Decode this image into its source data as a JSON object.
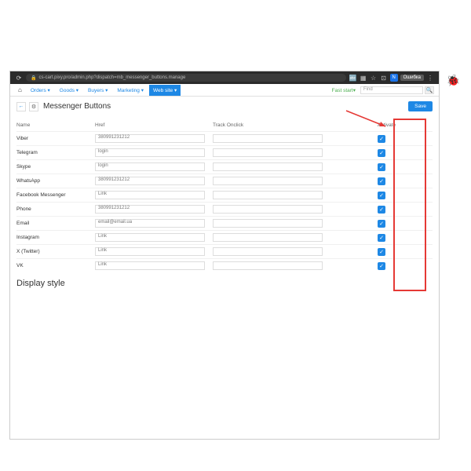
{
  "browser": {
    "url": "cs-cart.pixy.pro/admin.php?dispatch=mb_messenger_buttons.manage",
    "profile_initial": "N",
    "error_label": "Ошибка"
  },
  "nav": {
    "items": [
      "Orders",
      "Goods",
      "Buyers",
      "Marketing",
      "Web site"
    ],
    "active_index": 4,
    "fast_start": "Fast start",
    "find_placeholder": "Find"
  },
  "page": {
    "title": "Messenger Buttons",
    "save": "Save",
    "section2": "Display style"
  },
  "table": {
    "headers": {
      "name": "Name",
      "href": "Href",
      "track": "Track Onclick",
      "activate": "Activate"
    },
    "rows": [
      {
        "name": "Viber",
        "href": "380991231212",
        "track": "",
        "active": true
      },
      {
        "name": "Telegram",
        "href": "login",
        "track": "",
        "active": true
      },
      {
        "name": "Skype",
        "href": "login",
        "track": "",
        "active": true
      },
      {
        "name": "WhatsApp",
        "href": "380991231212",
        "track": "",
        "active": true
      },
      {
        "name": "Facebook Messenger",
        "href": "Link",
        "track": "",
        "active": true
      },
      {
        "name": "Phone",
        "href": "380991231212",
        "track": "",
        "active": true
      },
      {
        "name": "Email",
        "href": "email@email.ua",
        "track": "",
        "active": true
      },
      {
        "name": "Instagram",
        "href": "Link",
        "track": "",
        "active": true
      },
      {
        "name": "X (Twitter)",
        "href": "Link",
        "track": "",
        "active": true
      },
      {
        "name": "VK",
        "href": "Link",
        "track": "",
        "active": true
      }
    ]
  }
}
